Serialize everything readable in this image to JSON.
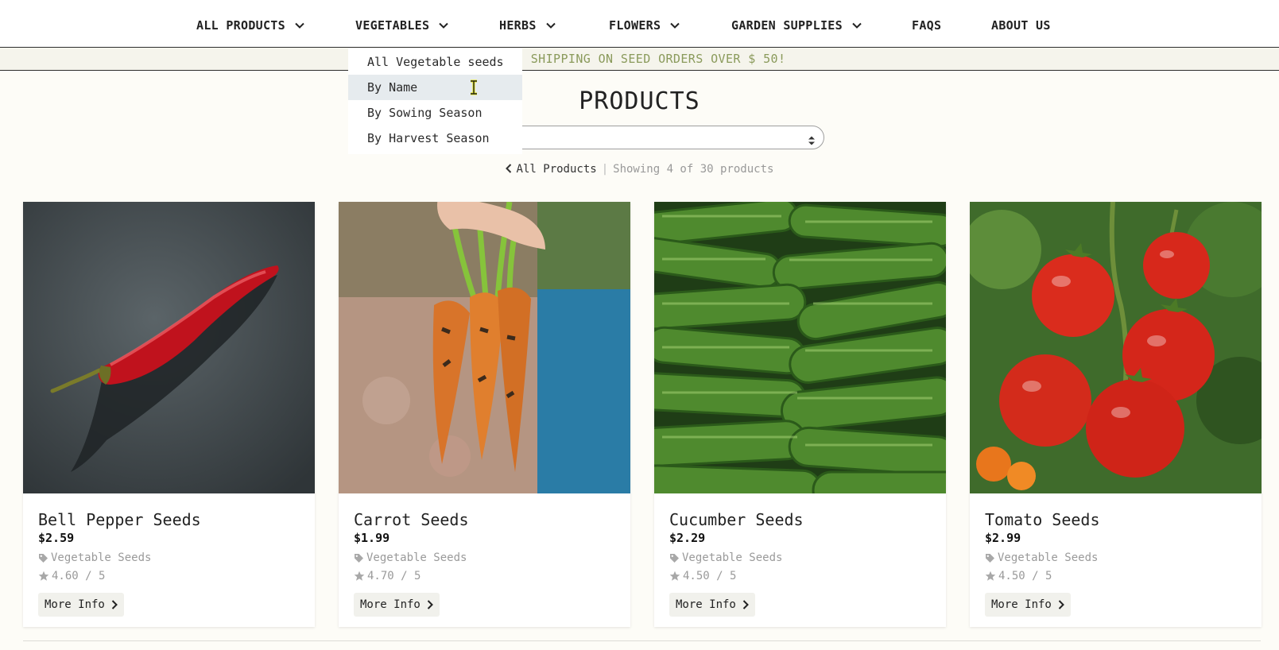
{
  "nav": {
    "items": [
      {
        "label": "ALL PRODUCTS",
        "has_dropdown": true
      },
      {
        "label": "VEGETABLES",
        "has_dropdown": true
      },
      {
        "label": "HERBS",
        "has_dropdown": true
      },
      {
        "label": "FLOWERS",
        "has_dropdown": true
      },
      {
        "label": "GARDEN SUPPLIES",
        "has_dropdown": true
      },
      {
        "label": "FAQS",
        "has_dropdown": false
      },
      {
        "label": "ABOUT US",
        "has_dropdown": false
      }
    ]
  },
  "banner": {
    "text": "FREE SHIPPING ON SEED ORDERS OVER $ 50!"
  },
  "dropdown": {
    "open_menu": "VEGETABLES",
    "items": [
      {
        "label": "All Vegetable seeds",
        "active": false
      },
      {
        "label": "By Name",
        "active": true
      },
      {
        "label": "By Sowing Season",
        "active": false
      },
      {
        "label": "By Harvest Season",
        "active": false
      }
    ]
  },
  "page": {
    "title": "PRODUCTS"
  },
  "sort": {
    "visible_value": ")"
  },
  "breadcrumb": {
    "back_label": "All Products",
    "separator": "|",
    "count_text": "Showing 4 of 30 products"
  },
  "products": [
    {
      "name": "Bell Pepper Seeds",
      "price": "$2.59",
      "category": "Vegetable Seeds",
      "rating": "4.60 / 5",
      "button": "More Info",
      "image": "red-chili-pepper-image"
    },
    {
      "name": "Carrot Seeds",
      "price": "$1.99",
      "category": "Vegetable Seeds",
      "rating": "4.70 / 5",
      "button": "More Info",
      "image": "carrots-bunch-image"
    },
    {
      "name": "Cucumber Seeds",
      "price": "$2.29",
      "category": "Vegetable Seeds",
      "rating": "4.50 / 5",
      "button": "More Info",
      "image": "cucumbers-pile-image"
    },
    {
      "name": "Tomato Seeds",
      "price": "$2.99",
      "category": "Vegetable Seeds",
      "rating": "4.50 / 5",
      "button": "More Info",
      "image": "tomatoes-on-vine-image"
    }
  ],
  "colors": {
    "page_bg": "#fdfcf7",
    "banner_text": "#8a9a5b",
    "dropdown_active_bg": "#e6ebee",
    "muted_text": "#9a9a9a"
  }
}
